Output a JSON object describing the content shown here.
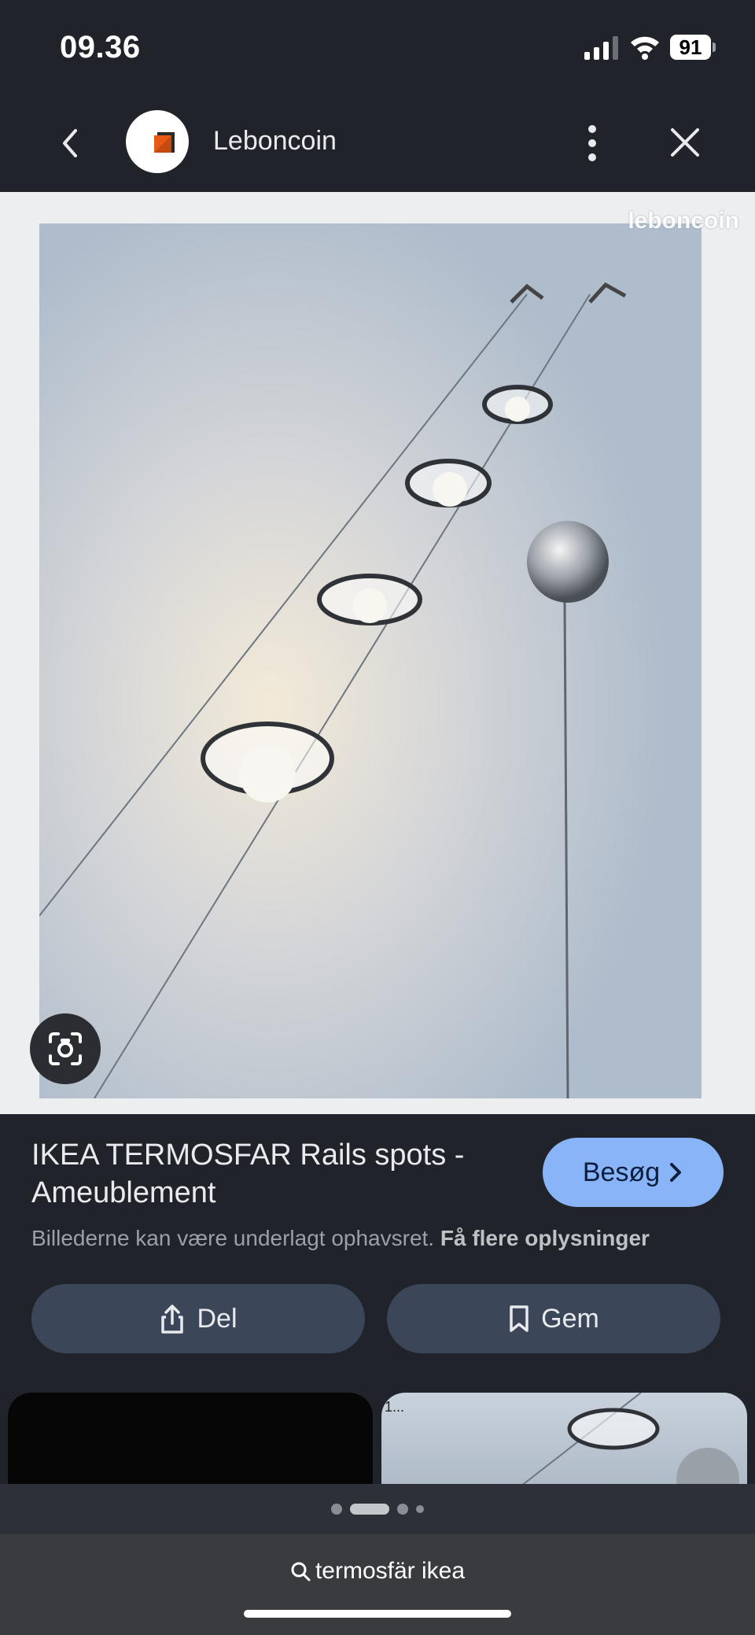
{
  "status_bar": {
    "time": "09.36",
    "battery": "91"
  },
  "header": {
    "site_name": "Leboncoin",
    "favicon_colors": {
      "bg": "#ffffff",
      "mark": "#e65a16",
      "shadow": "#2a2a2a"
    }
  },
  "image": {
    "watermark": "leboncoin"
  },
  "result": {
    "title": "IKEA TERMOSFAR Rails spots - Ameublement",
    "visit_label": "Besøg",
    "copyright_text": "Billederne kan være underlagt ophavsret.",
    "more_info_link": "Få flere oplysninger"
  },
  "actions": {
    "share_label": "Del",
    "save_label": "Gem"
  },
  "related": {
    "card2_text": "1..."
  },
  "pagination": {
    "count": 4,
    "active_index": 1
  },
  "bottom_bar": {
    "search_query": "termosfär ikea"
  },
  "colors": {
    "background": "#21232a",
    "accent": "#8ab4f8",
    "action_button": "#3b4658"
  }
}
